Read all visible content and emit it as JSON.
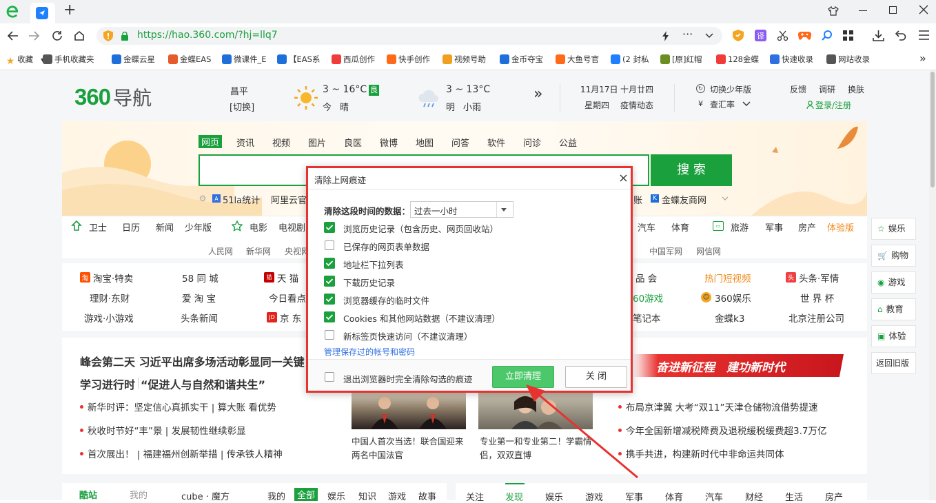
{
  "browser": {
    "url": "https://hao.360.com/?hj=llq7",
    "new_tab": "+",
    "bookmarks": [
      {
        "label": "收藏",
        "color": "#f4a623",
        "icon": "star-icon"
      },
      {
        "label": "手机收藏夹",
        "color": "#555555",
        "icon": "phone-icon"
      },
      {
        "label": "金蝶云星",
        "color": "#1e6fd9",
        "icon": "cube-icon"
      },
      {
        "label": "金蝶EAS",
        "color": "#e55b2b",
        "icon": "c-icon"
      },
      {
        "label": "微课件_E",
        "color": "#1e6fd9",
        "icon": "cube-icon"
      },
      {
        "label": "【EAS系",
        "color": "#1e6fd9",
        "icon": "cube-icon"
      },
      {
        "label": "西瓜创作",
        "color": "#f03b3b",
        "icon": "play-icon"
      },
      {
        "label": "快手创作",
        "color": "#ff6a1a",
        "icon": "kuaishou-icon"
      },
      {
        "label": "视频号助",
        "color": "#f0a020",
        "icon": "butterfly-icon"
      },
      {
        "label": "金币夺宝",
        "color": "#1e6fd9",
        "icon": "cube-icon"
      },
      {
        "label": "大鱼号官",
        "color": "#ff6a1a",
        "icon": "fish-icon"
      },
      {
        "label": "(2 封私",
        "color": "#1e80ff",
        "icon": "zhi-icon"
      },
      {
        "label": "[原]红帽",
        "color": "#6b8e23",
        "icon": "melon-icon"
      },
      {
        "label": "128金蝶",
        "color": "#f03b3b",
        "icon": "play-icon"
      },
      {
        "label": "快速收录",
        "color": "#2f6fe0",
        "icon": "paw-icon"
      },
      {
        "label": "网站收录",
        "color": "#555555",
        "icon": "globe-icon"
      }
    ]
  },
  "header": {
    "logo_num": "360",
    "logo_text": "导航",
    "city": "昌平",
    "switch": "[切换]",
    "today_temp": "3 ~ 16°C",
    "aqi": "良",
    "today_label": "今",
    "today_weather": "晴",
    "tmr_temp": "3 ~ 13°C",
    "tmr_label": "明",
    "tmr_weather": "小雨",
    "more": "»",
    "date": "11月17日",
    "lunar": "十月廿四",
    "weekday": "星期四",
    "epidemic": "疫情动态",
    "youth": "切换少年版",
    "rate": "查汇率",
    "feedback": "反馈",
    "survey": "调研",
    "skin": "换肤",
    "login": "登录/注册"
  },
  "search": {
    "tabs": [
      "网页",
      "资讯",
      "视频",
      "图片",
      "良医",
      "微博",
      "地图",
      "问答",
      "软件",
      "问诊",
      "公益"
    ],
    "button": "搜 索",
    "hot": [
      "51la统计",
      "阿里云官"
    ],
    "hot_right": [
      "账",
      "金蝶友商网"
    ]
  },
  "nav": {
    "left": [
      "卫士",
      "日历",
      "新闻",
      "少年版"
    ],
    "mid": [
      "电影",
      "电视剧"
    ],
    "right": [
      "汽车",
      "体育",
      "旅游",
      "军事",
      "房产",
      "体验版"
    ],
    "media_left": [
      "人民网",
      "新华网",
      "央视网"
    ],
    "media_right": [
      "中国军网",
      "网信网"
    ]
  },
  "links": {
    "row1": [
      "淘宝·特卖",
      "58 同 城",
      "天 猫"
    ],
    "row2": [
      "理财·东财",
      "爱 淘 宝",
      "今日看点"
    ],
    "row3": [
      "游戏·小游戏",
      "头条新闻",
      "京 东"
    ],
    "right1": [
      "品 会",
      "热门短视频",
      "头条·军情"
    ],
    "right2": [
      "60游戏",
      "360娱乐",
      "世 界 杯"
    ],
    "right3": [
      "笔记本",
      "金蝶k3",
      "北京注册公司"
    ]
  },
  "news": {
    "headline1": "峰会第二天 习近平出席多场活动彰显同一关键",
    "headline2": "学习进行时",
    "headline2b": "“促进人与自然和谐共生”",
    "items": [
      "新华时评：坚定信心真抓实干 | 算大账 看优势",
      "秋收时节好“丰”景 | 发展韧性继续彰显",
      "首次展出！ | 福建福州创新举措 | 传承铁人精神"
    ],
    "banner": "奋进新征程　建功新时代",
    "right_items": [
      "布局京津冀 大考“双11”天津仓储物流借势提速",
      "今年全国新增减税降费及退税缓税缓费超3.7万亿",
      "携手共进，构建新时代中非命运共同体"
    ],
    "img1_caption1": "中国人首次当选！联合国迎来",
    "img1_caption2": "两名中国法官",
    "img2_caption1": "专业第一和专业第二！学霸情",
    "img2_caption2": "侣，双双直博"
  },
  "side": [
    "娱乐",
    "购物",
    "游戏",
    "教育",
    "体验",
    "返回旧版"
  ],
  "bottom": {
    "tab_hot": "酷站",
    "tab_mine": "我的",
    "links": [
      "cube · 魔方",
      "我的",
      "全部",
      "娱乐",
      "知识",
      "游戏",
      "故事"
    ],
    "tabs_right": [
      "关注",
      "发现",
      "娱乐",
      "游戏",
      "军事",
      "体育",
      "汽车",
      "财经",
      "生活",
      "房产"
    ]
  },
  "dialog": {
    "title": "清除上网痕迹",
    "range_label": "清除这段时间的数据：",
    "range_value": "过去一小时",
    "options": [
      {
        "label": "浏览历史记录（包含历史、网页回收站）",
        "checked": true
      },
      {
        "label": "已保存的网页表单数据",
        "checked": false
      },
      {
        "label": "地址栏下拉列表",
        "checked": true
      },
      {
        "label": "下载历史记录",
        "checked": true
      },
      {
        "label": "浏览器缓存的临时文件",
        "checked": true
      },
      {
        "label": "Cookies 和其他网站数据（不建议清理）",
        "checked": true
      },
      {
        "label": "新标签页快速访问（不建议清理）",
        "checked": false
      }
    ],
    "manage_link": "管理保存过的帐号和密码",
    "exit_label": "退出浏览器时完全清除勾选的痕迹",
    "clear_btn": "立即清理",
    "close_btn": "关 闭"
  }
}
